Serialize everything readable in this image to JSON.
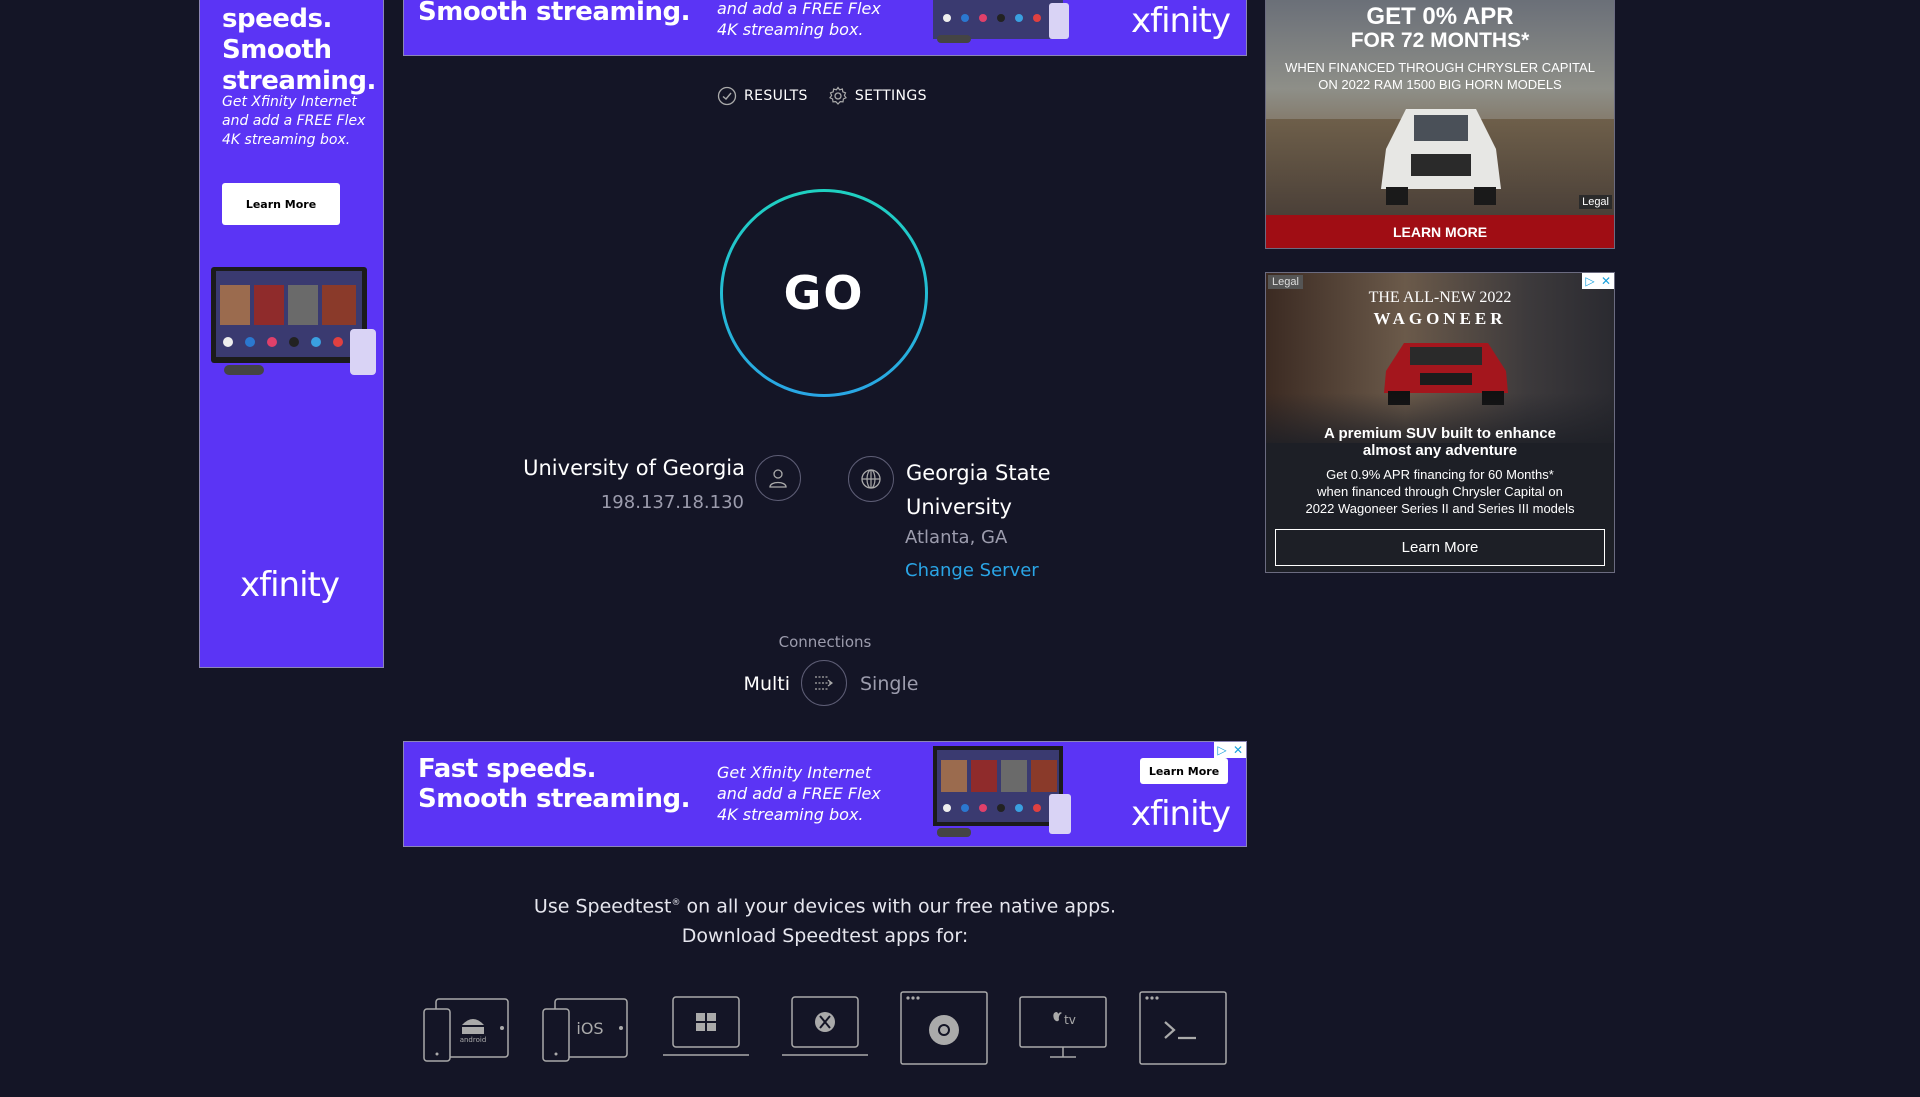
{
  "top_banner": {
    "headline": "Smooth streaming.",
    "text": "and add a FREE Flex 4K streaming box.",
    "logo": "xfinity"
  },
  "left_ad": {
    "headline": "Fast speeds. Smooth streaming.",
    "text": "Get Xfinity Internet and add a FREE Flex 4K streaming box.",
    "button": "Learn More",
    "logo": "xfinity"
  },
  "nav": {
    "results": "RESULTS",
    "settings": "SETTINGS"
  },
  "go_button": "GO",
  "isp": {
    "name": "University of Georgia",
    "ip": "198.137.18.130"
  },
  "server": {
    "name": "Georgia State University",
    "location": "Atlanta, GA",
    "change": "Change Server"
  },
  "connections": {
    "label": "Connections",
    "multi": "Multi",
    "single": "Single"
  },
  "bottom_banner": {
    "headline_line1": "Fast speeds.",
    "headline_line2": "Smooth streaming.",
    "text": "Get Xfinity Internet and add a FREE Flex 4K streaming box.",
    "button": "Learn More",
    "logo": "xfinity"
  },
  "apps": {
    "line1_prefix": "Use Speedtest",
    "reg": "®",
    "line1_suffix": " on all your devices with our free native apps.",
    "line2": "Download Speedtest apps for:",
    "icons": [
      "android-icon",
      "ios-icon",
      "windows-icon",
      "macos-icon",
      "chrome-icon",
      "appletv-icon",
      "cli-icon"
    ],
    "ios_label": "iOS",
    "android_label": "android",
    "tv_label": "tv"
  },
  "ram_ad": {
    "headline1": "GET 0% APR",
    "headline2": "FOR 72 MONTHS*",
    "sub1": "WHEN FINANCED THROUGH CHRYSLER CAPITAL",
    "sub2": "ON 2022 RAM 1500 BIG HORN MODELS",
    "cta": "LEARN MORE",
    "legal": "Legal"
  },
  "jeep_ad": {
    "legal": "Legal",
    "title1": "THE ALL-NEW 2022",
    "title2": "WAGONEER",
    "tagline1": "A premium SUV built to enhance",
    "tagline2": "almost any adventure",
    "fine1": "Get 0.9% APR financing for 60 Months*",
    "fine2": "when financed through Chrysler Capital on",
    "fine3": "2022 Wagoneer Series II and Series III models",
    "button": "Learn More"
  },
  "colors": {
    "background": "#141526",
    "ad_purple": "#5b34f5",
    "link_blue": "#2aa5e6",
    "go_ring_start": "#1fd1c1",
    "go_ring_end": "#29a6e5",
    "ram_red": "#a00d14"
  }
}
